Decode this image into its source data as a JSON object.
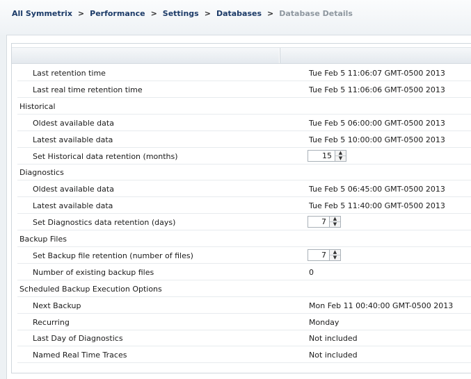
{
  "breadcrumb": [
    {
      "label": "All Symmetrix"
    },
    {
      "label": "Performance"
    },
    {
      "label": "Settings"
    },
    {
      "label": "Databases"
    },
    {
      "label": "Database Details"
    }
  ],
  "breadcrumb_separator": ">",
  "rows": [
    {
      "label": "Last retention time",
      "value": "Tue Feb 5 11:06:07 GMT-0500 2013"
    },
    {
      "label": "Last real time retention time",
      "value": "Tue Feb 5 11:06:06 GMT-0500 2013"
    },
    {
      "section": "Historical"
    },
    {
      "label": "Oldest available data",
      "value": "Tue Feb 5 06:00:00 GMT-0500 2013"
    },
    {
      "label": "Latest available data",
      "value": "Tue Feb 5 10:00:00 GMT-0500 2013"
    },
    {
      "label": "Set Historical data retention (months)",
      "spinner": "15"
    },
    {
      "section": "Diagnostics"
    },
    {
      "label": "Oldest available data",
      "value": "Tue Feb 5 06:45:00 GMT-0500 2013"
    },
    {
      "label": "Latest available data",
      "value": "Tue Feb 5 11:40:00 GMT-0500 2013"
    },
    {
      "label": "Set Diagnostics data retention (days)",
      "spinner": "7"
    },
    {
      "section": "Backup Files"
    },
    {
      "label": "Set Backup file retention (number of files)",
      "spinner": "7"
    },
    {
      "label": "Number of existing backup files",
      "value": "0"
    },
    {
      "section": "Scheduled Backup Execution Options"
    },
    {
      "label": "Next Backup",
      "value": "Mon Feb 11 00:40:00 GMT-0500 2013"
    },
    {
      "label": "Recurring",
      "value": "Monday"
    },
    {
      "label": "Last Day of Diagnostics",
      "value": "Not included"
    },
    {
      "label": "Named Real Time Traces",
      "value": "Not included"
    }
  ],
  "icons": {
    "spinner_up": "spinner-up-arrow-icon",
    "spinner_down": "spinner-down-arrow-icon"
  },
  "colors": {
    "breadcrumb_link": "#1b3a67",
    "breadcrumb_current": "#8e979f",
    "header_bg": "#e4e9ee"
  }
}
